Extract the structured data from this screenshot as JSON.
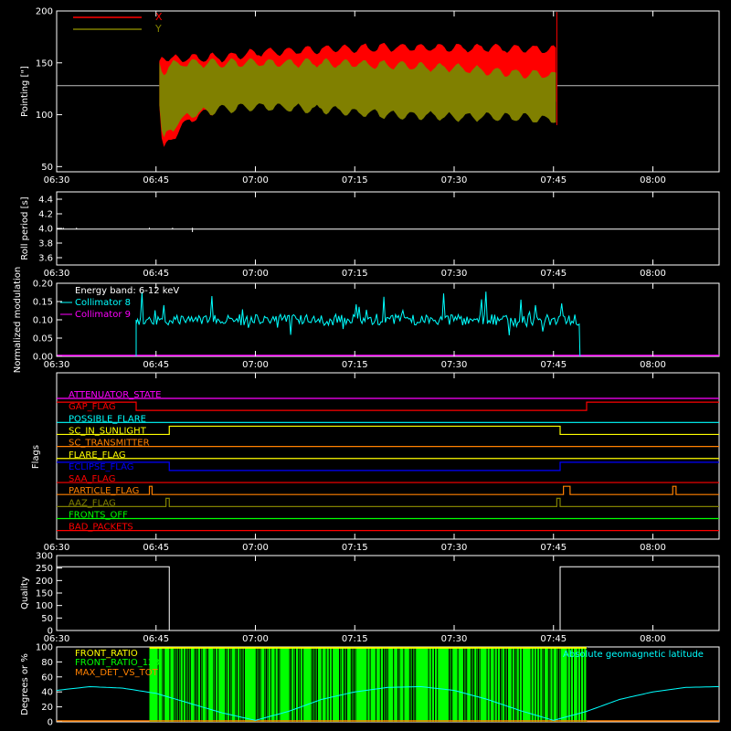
{
  "colors": {
    "background": "#000000",
    "axes": "#ffffff",
    "x_pointing": "#ff0000",
    "y_pointing": "#808000",
    "collimator8": "#00ffff",
    "collimator9": "#ff00ff",
    "front_ratio": "#00ff00",
    "front_ratio_123": "#ffff00",
    "max_det": "#ff8000",
    "geomag": "#00ffff"
  },
  "time_axis": {
    "tick_labels": [
      "06:30",
      "06:45",
      "07:00",
      "07:15",
      "07:30",
      "07:45",
      "08:00"
    ],
    "tick_minutes": [
      0,
      15,
      30,
      45,
      60,
      75,
      90
    ],
    "range_minutes": [
      0,
      100
    ]
  },
  "chart_data": [
    {
      "type": "area",
      "ylabel": "Pointing [\"]",
      "ylim": [
        45,
        200
      ],
      "yticks": [
        "50",
        "100",
        "150",
        "200"
      ],
      "ytick_values": [
        50,
        100,
        150,
        200
      ],
      "legend": "top-left",
      "series": [
        {
          "name": "X",
          "color": "#ff0000",
          "x_min": [
            15.5,
            16,
            17,
            20,
            25,
            30,
            40,
            50,
            60,
            70,
            75.5
          ],
          "upper": [
            150,
            160,
            153,
            155,
            155,
            160,
            163,
            165,
            165,
            164,
            162
          ],
          "lower": [
            110,
            62,
            75,
            95,
            108,
            113,
            118,
            115,
            117,
            119,
            115
          ]
        },
        {
          "name": "Y",
          "color": "#808000",
          "x_min": [
            15.5,
            16,
            17,
            20,
            25,
            30,
            40,
            50,
            60,
            70,
            75.5
          ],
          "upper": [
            150,
            140,
            148,
            150,
            150,
            150,
            150,
            148,
            145,
            140,
            138
          ],
          "lower": [
            110,
            72,
            85,
            100,
            105,
            108,
            105,
            100,
            98,
            97,
            95
          ]
        }
      ],
      "baseline": 128
    },
    {
      "type": "line",
      "ylabel": "Roll period [s]",
      "ylim": [
        3.5,
        4.5
      ],
      "yticks": [
        "3.6",
        "3.8",
        "4.0",
        "4.2",
        "4.4"
      ],
      "ytick_values": [
        3.6,
        3.8,
        4.0,
        4.2,
        4.4
      ],
      "series": [
        {
          "name": "",
          "x_min": [
            0,
            100
          ],
          "values": [
            3.99,
            3.99
          ],
          "dips_min": [
            1,
            3,
            14,
            17.5,
            20.5
          ]
        }
      ]
    },
    {
      "type": "line",
      "ylabel": "Normalized modulation",
      "ylim": [
        0,
        0.2
      ],
      "yticks": [
        "0.00",
        "0.05",
        "0.10",
        "0.15",
        "0.20"
      ],
      "ytick_values": [
        0,
        0.05,
        0.1,
        0.15,
        0.2
      ],
      "legend_title": "Energy band: 6-12 keV",
      "series": [
        {
          "name": "Collimator 8",
          "color": "#00ffff",
          "x_range_min": [
            12,
            79
          ],
          "mean": 0.1
        },
        {
          "name": "Collimator 9",
          "color": "#ff00ff",
          "values": 0
        }
      ]
    },
    {
      "type": "line",
      "ylabel": "Flags",
      "flags": [
        {
          "name": "ATTENUATOR_STATE",
          "color": "#ff00ff",
          "high_min": []
        },
        {
          "name": "GAP_FLAG",
          "color": "#ff0000",
          "high_min": [
            [
              0,
              12
            ],
            [
              80,
              100
            ]
          ]
        },
        {
          "name": "POSSIBLE_FLARE",
          "color": "#00ffff",
          "high_min": []
        },
        {
          "name": "SC_IN_SUNLIGHT",
          "color": "#ffff00",
          "high_min": [
            [
              17,
              76
            ]
          ]
        },
        {
          "name": "SC_TRANSMITTER",
          "color": "#ff8000",
          "high_min": []
        },
        {
          "name": "FLARE_FLAG",
          "color": "#ffff00",
          "high_min": []
        },
        {
          "name": "ECLIPSE_FLAG",
          "color": "#0000ff",
          "high_min": [
            [
              0,
              17
            ],
            [
              76,
              100
            ]
          ]
        },
        {
          "name": "SAA_FLAG",
          "color": "#ff0000",
          "high_min": []
        },
        {
          "name": "PARTICLE_FLAG",
          "color": "#ff8000",
          "high_min": [
            [
              14,
              14.4
            ],
            [
              76.5,
              77.5
            ],
            [
              93,
              93.5
            ]
          ]
        },
        {
          "name": "AAZ_FLAG",
          "color": "#808000",
          "high_min": [
            [
              16.5,
              17
            ],
            [
              75.5,
              76
            ]
          ]
        },
        {
          "name": "FRONTS_OFF",
          "color": "#00ff00",
          "high_min": []
        },
        {
          "name": "BAD_PACKETS",
          "color": "#ff0000",
          "high_min": []
        }
      ]
    },
    {
      "type": "line",
      "ylabel": "Quality",
      "ylim": [
        0,
        300
      ],
      "yticks": [
        "0",
        "50",
        "100",
        "150",
        "200",
        "250",
        "300"
      ],
      "ytick_values": [
        0,
        50,
        100,
        150,
        200,
        250,
        300
      ],
      "series": [
        {
          "name": "",
          "x_min": [
            0,
            17,
            17,
            76,
            76,
            100
          ],
          "values": [
            255,
            255,
            0,
            0,
            255,
            255
          ]
        }
      ]
    },
    {
      "type": "line",
      "ylabel": "Degrees or %",
      "ylim": [
        0,
        100
      ],
      "yticks": [
        "0",
        "20",
        "40",
        "60",
        "80",
        "100"
      ],
      "ytick_values": [
        0,
        20,
        40,
        60,
        80,
        100
      ],
      "series": [
        {
          "name": "FRONT_RATIO",
          "color": "#00ff00",
          "x_range_min": [
            14,
            80
          ]
        },
        {
          "name": "FRONT_RATIO_123",
          "color": "#ffff00"
        },
        {
          "name": "MAX_DET_VS_TOT",
          "color": "#ff8000"
        },
        {
          "name": "Absolute geomagnetic latitude",
          "color": "#00ffff",
          "x_min": [
            0,
            5,
            10,
            15,
            20,
            25,
            30,
            35,
            40,
            45,
            50,
            55,
            60,
            65,
            70,
            75,
            80,
            85,
            90,
            95,
            100
          ],
          "values": [
            42,
            47,
            45,
            38,
            25,
            12,
            2,
            14,
            30,
            40,
            46,
            47,
            42,
            30,
            15,
            2,
            14,
            30,
            40,
            46,
            47
          ]
        }
      ]
    }
  ]
}
